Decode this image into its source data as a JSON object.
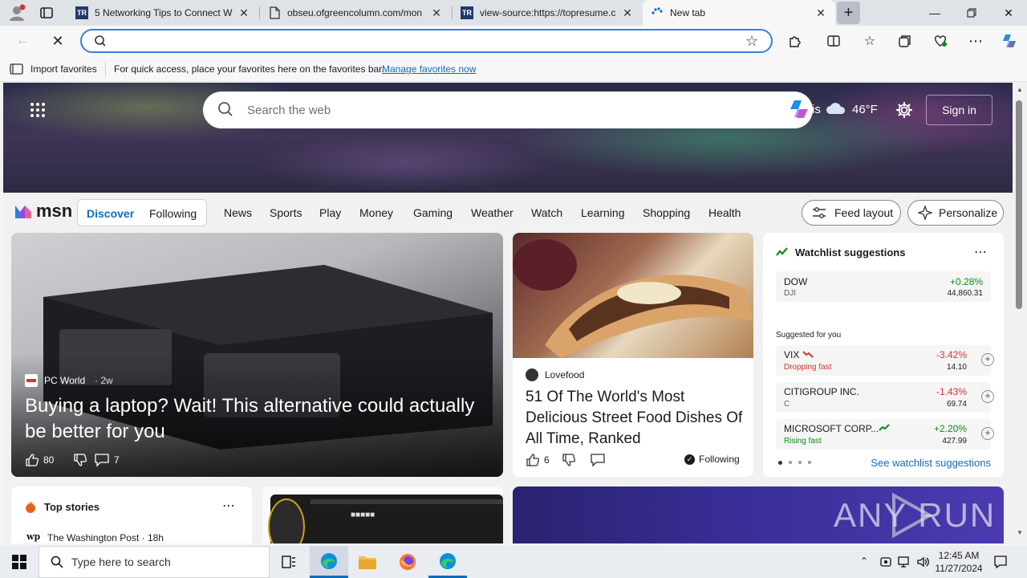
{
  "browser": {
    "tabs": [
      {
        "title": "5 Networking Tips to Connect Wi",
        "favicon": "TR"
      },
      {
        "title": "obseu.ofgreencolumn.com/mon",
        "favicon": "doc"
      },
      {
        "title": "view-source:https://topresume.c",
        "favicon": "TR"
      },
      {
        "title": "New tab",
        "favicon": "loading"
      }
    ],
    "new_tab_symbol": "+",
    "favorites_bar": {
      "import_label": "Import favorites",
      "hint": "For quick access, place your favorites here on the favorites bar.",
      "manage_link": "Manage favorites now"
    }
  },
  "msn": {
    "search_placeholder": "Search the web",
    "weather_city_partial": "is",
    "weather_temp": "46°F",
    "sign_in": "Sign in",
    "logo_text": "msn",
    "feed_tabs": [
      "Discover",
      "Following"
    ],
    "nav_links": [
      "News",
      "Sports",
      "Play",
      "Money",
      "Gaming",
      "Weather",
      "Watch",
      "Learning",
      "Shopping",
      "Health"
    ],
    "feed_layout": "Feed layout",
    "personalize": "Personalize",
    "hero_card": {
      "source": "PC World",
      "age": "2w",
      "title": "Buying a laptop? Wait! This alternative could actually be better for you",
      "likes": "80",
      "comments": "7"
    },
    "food_card": {
      "source": "Lovefood",
      "title": "51 Of The World's Most Delicious Street Food Dishes Of All Time, Ranked",
      "likes": "6",
      "following": "Following"
    },
    "watchlist": {
      "title": "Watchlist suggestions",
      "index": {
        "name": "DOW",
        "sub": "DJI",
        "change": "+0.28%",
        "value": "44,860.31"
      },
      "suggested_label": "Suggested for you",
      "stocks": [
        {
          "name": "VIX",
          "sub": "Dropping fast",
          "change": "-3.42%",
          "value": "14.10",
          "dir": "down"
        },
        {
          "name": "CITIGROUP INC.",
          "sub": "C",
          "change": "-1.43%",
          "value": "69.74",
          "dir": "down"
        },
        {
          "name": "MICROSOFT CORP...",
          "sub": "Rising fast",
          "change": "+2.20%",
          "value": "427.99",
          "dir": "up"
        }
      ],
      "see_more": "See watchlist suggestions"
    },
    "top_stories": {
      "title": "Top stories",
      "first_source": "The Washington Post · 18h"
    },
    "watermark": "ANY RUN"
  },
  "taskbar": {
    "search_placeholder": "Type here to search",
    "time": "12:45 AM",
    "date": "11/27/2024"
  },
  "colors": {
    "accent": "#0f6cbd",
    "up": "#0b8a1b",
    "down": "#d13438"
  }
}
